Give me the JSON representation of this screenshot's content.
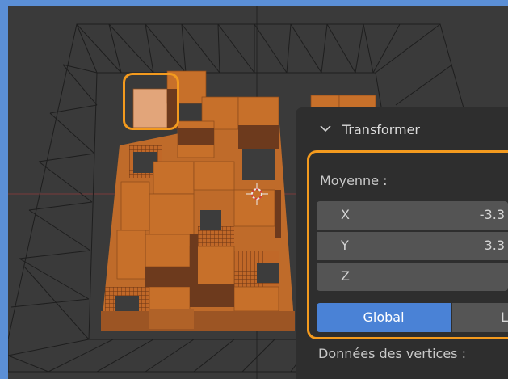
{
  "panel": {
    "title": "Transformer",
    "section_label": "Moyenne :",
    "fields": [
      {
        "label": "X",
        "value": "-3.3"
      },
      {
        "label": "Y",
        "value": "3.3"
      },
      {
        "label": "Z",
        "value": ""
      }
    ],
    "orientation": {
      "active": "Global",
      "inactive": "L"
    },
    "vertex_data_label": "Données des vertices :"
  },
  "colors": {
    "frame": "#5b8fd6",
    "highlight": "#f39a1e",
    "block_top": "#cc7129",
    "block_side": "#6d3a1d",
    "button_active": "#4a82d6"
  },
  "icons": [
    "chevron-down-icon",
    "3d-cursor-icon"
  ]
}
